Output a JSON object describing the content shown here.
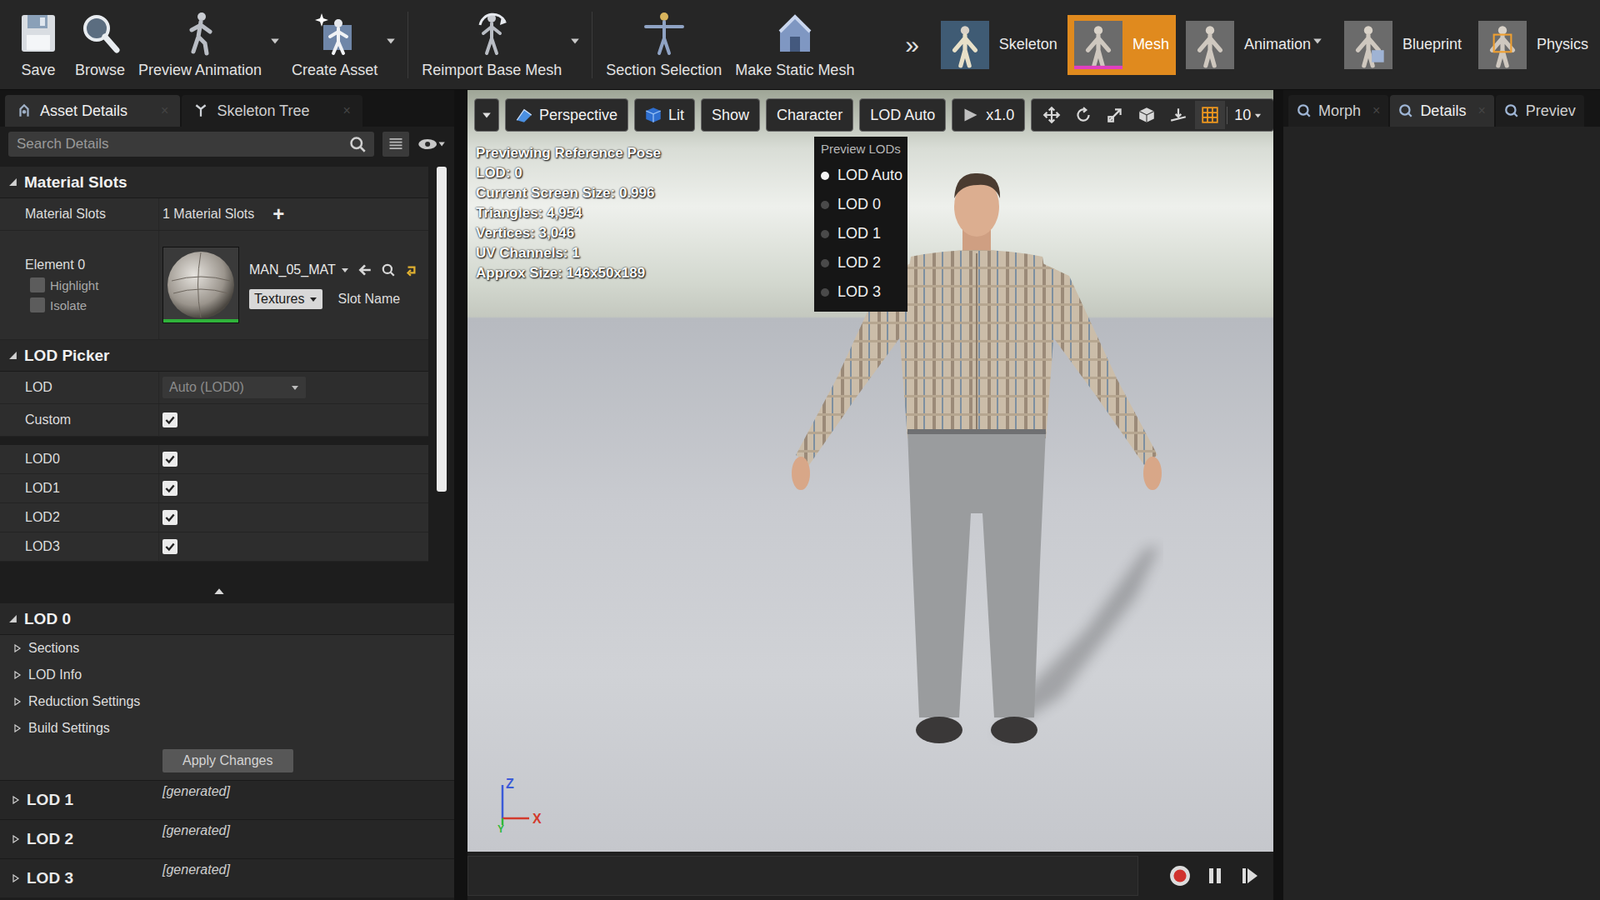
{
  "toolbar": {
    "buttons": [
      {
        "label": "Save",
        "kind": "floppy",
        "dropdown": false
      },
      {
        "label": "Browse",
        "kind": "magnifier",
        "dropdown": false
      },
      {
        "label": "Preview Animation",
        "kind": "running-figure",
        "dropdown": true
      },
      {
        "label": "Create Asset",
        "kind": "figure-star",
        "dropdown": true
      },
      {
        "label": "Reimport Base Mesh",
        "kind": "figure-arrow",
        "dropdown": true
      },
      {
        "label": "Section Selection",
        "kind": "t-pose-figure",
        "dropdown": false
      },
      {
        "label": "Make Static Mesh",
        "kind": "static-mesh",
        "dropdown": false
      }
    ],
    "overflow": "»",
    "modes": [
      {
        "label": "Skeleton",
        "kind": "skeleton",
        "selected": false,
        "dropdown": false
      },
      {
        "label": "Mesh",
        "kind": "mesh",
        "selected": true,
        "dropdown": false
      },
      {
        "label": "Animation",
        "kind": "animation",
        "selected": false,
        "dropdown": true
      },
      {
        "label": "Blueprint",
        "kind": "blueprint",
        "selected": false,
        "dropdown": false
      },
      {
        "label": "Physics",
        "kind": "physics",
        "selected": false,
        "dropdown": false
      }
    ]
  },
  "left_panel": {
    "tabs": [
      {
        "label": "Asset Details",
        "kind": "details",
        "selected": true,
        "close": "×"
      },
      {
        "label": "Skeleton Tree",
        "kind": "tree",
        "selected": false,
        "close": "×"
      }
    ],
    "search": {
      "placeholder": "Search Details"
    },
    "scrollbar": {
      "level": 0.78
    },
    "material_slots": {
      "title": "Material Slots",
      "expanded": true,
      "row_label": "Material Slots",
      "count": "1 Material Slots",
      "add": "+",
      "element": {
        "label": "Element 0",
        "options": [
          {
            "label": "Highlight",
            "checked": false
          },
          {
            "label": "Isolate",
            "checked": false
          }
        ],
        "material": "MAN_05_MAT",
        "textures": "Textures",
        "slot_name": "Slot Name"
      }
    },
    "lod_picker": {
      "title": "LOD Picker",
      "expanded": true,
      "lod_label": "LOD",
      "lod_value": "Auto (LOD0)",
      "lod_disabled": true,
      "custom": {
        "label": "Custom",
        "checked": true
      },
      "lods": [
        {
          "label": "LOD0",
          "checked": true
        },
        {
          "label": "LOD1",
          "checked": true
        },
        {
          "label": "LOD2",
          "checked": true
        },
        {
          "label": "LOD3",
          "checked": true
        }
      ]
    },
    "lod0": {
      "title": "LOD 0",
      "expanded": true,
      "groups": [
        {
          "label": "Sections",
          "expanded": false
        },
        {
          "label": "LOD Info",
          "expanded": false
        },
        {
          "label": "Reduction Settings",
          "expanded": false
        },
        {
          "label": "Build Settings",
          "expanded": false
        }
      ],
      "apply": "Apply Changes"
    },
    "other_lods": [
      {
        "title": "LOD 1",
        "expanded": false,
        "note": "[generated]"
      },
      {
        "title": "LOD 2",
        "expanded": false,
        "note": "[generated]"
      },
      {
        "title": "LOD 3",
        "expanded": false,
        "note": "[generated]"
      }
    ]
  },
  "viewport": {
    "toolbar": {
      "buttons": [
        {
          "label": "Perspective",
          "kind": "perspective"
        },
        {
          "label": "Lit",
          "kind": "lit"
        },
        {
          "label": "Show",
          "kind": "plain"
        },
        {
          "label": "Character",
          "kind": "plain"
        },
        {
          "label": "LOD Auto",
          "kind": "plain"
        },
        {
          "label": "x1.0",
          "kind": "play"
        }
      ],
      "tools": [
        {
          "kind": "translate",
          "active": false
        },
        {
          "kind": "rotate",
          "active": false
        },
        {
          "kind": "scale",
          "active": false
        },
        {
          "kind": "cube",
          "active": false
        },
        {
          "kind": "surface-snap",
          "active": false
        },
        {
          "kind": "grid",
          "active": true
        }
      ],
      "grid_value": "10"
    },
    "info": [
      "Previewing Reference Pose",
      "LOD: 0",
      "Current Screen Size: 0.996",
      "Triangles: 4,954",
      "Vertices: 3,046",
      "UV Channels: 1",
      "Approx Size: 146x50x189"
    ],
    "lod_menu": {
      "title": "Preview LODs",
      "items": [
        {
          "label": "LOD Auto",
          "selected": true
        },
        {
          "label": "LOD 0",
          "selected": false
        },
        {
          "label": "LOD 1",
          "selected": false
        },
        {
          "label": "LOD 2",
          "selected": false
        },
        {
          "label": "LOD 3",
          "selected": false
        }
      ]
    },
    "axes": {
      "z": "Z",
      "x": "X",
      "y": "Y"
    }
  },
  "right_panel": {
    "tabs": [
      {
        "label": "Morph",
        "selected": false,
        "close": "×"
      },
      {
        "label": "Details",
        "selected": true,
        "close": "×"
      },
      {
        "label": "Previev",
        "selected": false,
        "close": ""
      }
    ]
  }
}
